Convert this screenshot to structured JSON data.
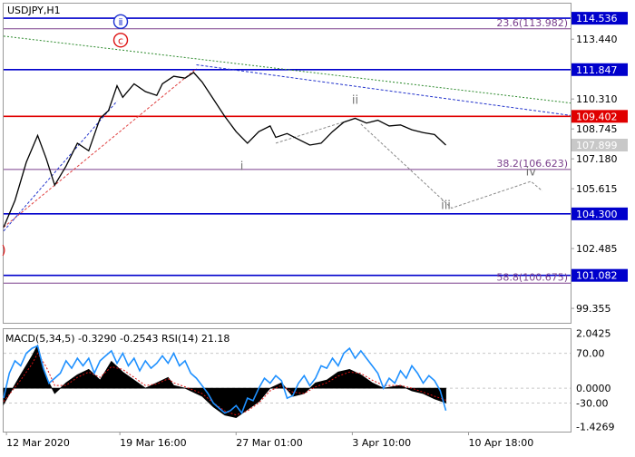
{
  "chart_data": [
    {
      "type": "line",
      "symbol_label": "USDJPY,H1",
      "y_ticks": [
        {
          "value": 113.44,
          "label": "113.440"
        },
        {
          "value": 110.31,
          "label": "110.310"
        },
        {
          "value": 108.745,
          "label": "108.745"
        },
        {
          "value": 107.18,
          "label": "107.180"
        },
        {
          "value": 105.615,
          "label": "105.615"
        },
        {
          "value": 102.485,
          "label": "102.485"
        },
        {
          "value": 99.355,
          "label": "99.355"
        }
      ],
      "ylim": [
        98.6,
        115.3
      ],
      "horizontal_levels": [
        {
          "value": 114.536,
          "label": "114.536",
          "color": "#0000cc",
          "style": "solid"
        },
        {
          "value": 111.847,
          "label": "111.847",
          "color": "#0000cc",
          "style": "solid"
        },
        {
          "value": 109.402,
          "label": "109.402",
          "color": "#e00000",
          "style": "solid"
        },
        {
          "value": 104.3,
          "label": "104.300",
          "color": "#0000cc",
          "style": "solid"
        },
        {
          "value": 101.082,
          "label": "101.082",
          "color": "#0000cc",
          "style": "solid"
        }
      ],
      "fib_levels": [
        {
          "value": 113.982,
          "label": "23.6(113.982)"
        },
        {
          "value": 106.623,
          "label": "38.2(106.623)"
        },
        {
          "value": 100.675,
          "label": "58.8(100.675)"
        }
      ],
      "current_price": {
        "value": 107.899,
        "label": "107.899"
      },
      "wave_labels": [
        {
          "label": "ⅱ",
          "x": 0.2,
          "y": 114.17,
          "style": "circled-blue"
        },
        {
          "label": "c",
          "x": 0.2,
          "y": 113.2,
          "style": "circled-red"
        },
        {
          "label": ")",
          "x": 0.0,
          "y": 102.2,
          "style": "red"
        },
        {
          "label": "i",
          "x": 0.42,
          "y": 106.6,
          "style": "gray"
        },
        {
          "label": "ii",
          "x": 0.62,
          "y": 110.05,
          "style": "gray"
        },
        {
          "label": "iii",
          "x": 0.78,
          "y": 104.55,
          "style": "gray"
        },
        {
          "label": "iv",
          "x": 0.93,
          "y": 106.3,
          "style": "gray"
        }
      ],
      "price_series": [
        [
          0.0,
          103.6
        ],
        [
          0.02,
          105.0
        ],
        [
          0.04,
          107.0
        ],
        [
          0.06,
          108.4
        ],
        [
          0.075,
          107.2
        ],
        [
          0.09,
          105.8
        ],
        [
          0.11,
          106.8
        ],
        [
          0.13,
          108.0
        ],
        [
          0.15,
          107.6
        ],
        [
          0.17,
          109.3
        ],
        [
          0.185,
          109.7
        ],
        [
          0.2,
          111.0
        ],
        [
          0.21,
          110.4
        ],
        [
          0.23,
          111.1
        ],
        [
          0.25,
          110.7
        ],
        [
          0.27,
          110.5
        ],
        [
          0.28,
          111.1
        ],
        [
          0.3,
          111.5
        ],
        [
          0.32,
          111.4
        ],
        [
          0.335,
          111.7
        ],
        [
          0.35,
          111.2
        ],
        [
          0.37,
          110.3
        ],
        [
          0.39,
          109.4
        ],
        [
          0.41,
          108.6
        ],
        [
          0.43,
          108.0
        ],
        [
          0.45,
          108.6
        ],
        [
          0.47,
          108.9
        ],
        [
          0.48,
          108.3
        ],
        [
          0.5,
          108.5
        ],
        [
          0.52,
          108.2
        ],
        [
          0.54,
          107.9
        ],
        [
          0.56,
          108.0
        ],
        [
          0.58,
          108.6
        ],
        [
          0.6,
          109.1
        ],
        [
          0.62,
          109.3
        ],
        [
          0.64,
          109.05
        ],
        [
          0.66,
          109.2
        ],
        [
          0.68,
          108.9
        ],
        [
          0.7,
          108.95
        ],
        [
          0.72,
          108.7
        ],
        [
          0.74,
          108.55
        ],
        [
          0.76,
          108.45
        ],
        [
          0.78,
          107.9
        ]
      ],
      "wave_path_ii_iii_iv": [
        [
          0.63,
          109.0
        ],
        [
          0.79,
          104.6
        ],
        [
          0.93,
          106.0
        ],
        [
          0.95,
          105.5
        ]
      ],
      "wave_path_i_ii": [
        [
          0.48,
          108.0
        ],
        [
          0.62,
          109.3
        ]
      ]
    },
    {
      "type": "line",
      "indicator_label": "MACD(5,34,5) -0.3290 -0.2543 RSI(14) 21.18",
      "left_ticks": [
        {
          "value": 2.0425,
          "label": "2.0425"
        },
        {
          "value": 0.0,
          "label": "0.0000"
        },
        {
          "value": -1.4269,
          "label": "-1.4269"
        }
      ],
      "right_ticks": [
        {
          "value": 70,
          "label": "70.00"
        },
        {
          "value": -30,
          "label": "-30.00"
        }
      ],
      "x_tick_labels": [
        "12 Mar 2020",
        "19 Mar 16:00",
        "27 Mar 01:00",
        "3 Apr 10:00",
        "10 Apr 18:00"
      ],
      "macd_hist": [
        [
          0.0,
          -0.6
        ],
        [
          0.03,
          0.5
        ],
        [
          0.05,
          1.2
        ],
        [
          0.06,
          1.6
        ],
        [
          0.075,
          0.4
        ],
        [
          0.09,
          -0.2
        ],
        [
          0.11,
          0.2
        ],
        [
          0.13,
          0.5
        ],
        [
          0.15,
          0.7
        ],
        [
          0.17,
          0.3
        ],
        [
          0.19,
          1.0
        ],
        [
          0.21,
          0.6
        ],
        [
          0.23,
          0.3
        ],
        [
          0.25,
          0.0
        ],
        [
          0.27,
          0.2
        ],
        [
          0.29,
          0.4
        ],
        [
          0.3,
          0.1
        ],
        [
          0.32,
          0.0
        ],
        [
          0.35,
          -0.3
        ],
        [
          0.37,
          -0.7
        ],
        [
          0.39,
          -1.0
        ],
        [
          0.41,
          -1.1
        ],
        [
          0.43,
          -0.8
        ],
        [
          0.45,
          -0.5
        ],
        [
          0.47,
          0.0
        ],
        [
          0.49,
          0.2
        ],
        [
          0.51,
          -0.3
        ],
        [
          0.53,
          -0.2
        ],
        [
          0.55,
          0.2
        ],
        [
          0.57,
          0.3
        ],
        [
          0.59,
          0.6
        ],
        [
          0.61,
          0.7
        ],
        [
          0.63,
          0.5
        ],
        [
          0.65,
          0.2
        ],
        [
          0.67,
          0.0
        ],
        [
          0.7,
          0.1
        ],
        [
          0.72,
          -0.1
        ],
        [
          0.74,
          -0.2
        ],
        [
          0.76,
          -0.4
        ],
        [
          0.78,
          -0.55
        ]
      ],
      "macd_signal": [
        [
          0.0,
          -0.5
        ],
        [
          0.03,
          0.3
        ],
        [
          0.05,
          0.9
        ],
        [
          0.06,
          1.3
        ],
        [
          0.075,
          0.8
        ],
        [
          0.09,
          0.1
        ],
        [
          0.11,
          0.1
        ],
        [
          0.13,
          0.4
        ],
        [
          0.15,
          0.6
        ],
        [
          0.17,
          0.4
        ],
        [
          0.19,
          0.8
        ],
        [
          0.21,
          0.7
        ],
        [
          0.23,
          0.4
        ],
        [
          0.25,
          0.1
        ],
        [
          0.27,
          0.15
        ],
        [
          0.29,
          0.35
        ],
        [
          0.3,
          0.2
        ],
        [
          0.32,
          0.05
        ],
        [
          0.35,
          -0.2
        ],
        [
          0.37,
          -0.55
        ],
        [
          0.39,
          -0.85
        ],
        [
          0.41,
          -1.0
        ],
        [
          0.43,
          -0.85
        ],
        [
          0.45,
          -0.55
        ],
        [
          0.47,
          -0.1
        ],
        [
          0.49,
          0.1
        ],
        [
          0.51,
          -0.15
        ],
        [
          0.53,
          -0.2
        ],
        [
          0.55,
          0.05
        ],
        [
          0.57,
          0.2
        ],
        [
          0.59,
          0.45
        ],
        [
          0.61,
          0.6
        ],
        [
          0.63,
          0.55
        ],
        [
          0.65,
          0.3
        ],
        [
          0.67,
          0.1
        ],
        [
          0.7,
          0.1
        ],
        [
          0.72,
          0.0
        ],
        [
          0.74,
          -0.15
        ],
        [
          0.76,
          -0.3
        ],
        [
          0.78,
          -0.45
        ]
      ],
      "rsi": [
        [
          0.0,
          -20
        ],
        [
          0.01,
          30
        ],
        [
          0.02,
          55
        ],
        [
          0.03,
          45
        ],
        [
          0.04,
          70
        ],
        [
          0.05,
          80
        ],
        [
          0.06,
          85
        ],
        [
          0.07,
          40
        ],
        [
          0.08,
          10
        ],
        [
          0.09,
          20
        ],
        [
          0.1,
          30
        ],
        [
          0.11,
          55
        ],
        [
          0.12,
          40
        ],
        [
          0.13,
          60
        ],
        [
          0.14,
          45
        ],
        [
          0.15,
          60
        ],
        [
          0.16,
          30
        ],
        [
          0.17,
          55
        ],
        [
          0.18,
          65
        ],
        [
          0.19,
          75
        ],
        [
          0.2,
          50
        ],
        [
          0.21,
          70
        ],
        [
          0.22,
          45
        ],
        [
          0.23,
          60
        ],
        [
          0.24,
          35
        ],
        [
          0.25,
          55
        ],
        [
          0.26,
          40
        ],
        [
          0.27,
          50
        ],
        [
          0.28,
          65
        ],
        [
          0.29,
          50
        ],
        [
          0.3,
          70
        ],
        [
          0.31,
          45
        ],
        [
          0.32,
          55
        ],
        [
          0.33,
          30
        ],
        [
          0.34,
          20
        ],
        [
          0.35,
          5
        ],
        [
          0.36,
          -10
        ],
        [
          0.37,
          -30
        ],
        [
          0.38,
          -40
        ],
        [
          0.39,
          -50
        ],
        [
          0.4,
          -45
        ],
        [
          0.41,
          -35
        ],
        [
          0.42,
          -50
        ],
        [
          0.43,
          -20
        ],
        [
          0.44,
          -25
        ],
        [
          0.45,
          0
        ],
        [
          0.46,
          20
        ],
        [
          0.47,
          10
        ],
        [
          0.48,
          25
        ],
        [
          0.49,
          15
        ],
        [
          0.5,
          -20
        ],
        [
          0.51,
          -15
        ],
        [
          0.52,
          10
        ],
        [
          0.53,
          25
        ],
        [
          0.54,
          5
        ],
        [
          0.55,
          20
        ],
        [
          0.56,
          45
        ],
        [
          0.57,
          40
        ],
        [
          0.58,
          60
        ],
        [
          0.59,
          45
        ],
        [
          0.6,
          70
        ],
        [
          0.61,
          80
        ],
        [
          0.62,
          60
        ],
        [
          0.63,
          75
        ],
        [
          0.64,
          60
        ],
        [
          0.65,
          45
        ],
        [
          0.66,
          30
        ],
        [
          0.67,
          0
        ],
        [
          0.68,
          20
        ],
        [
          0.69,
          10
        ],
        [
          0.7,
          35
        ],
        [
          0.71,
          20
        ],
        [
          0.72,
          45
        ],
        [
          0.73,
          30
        ],
        [
          0.74,
          10
        ],
        [
          0.75,
          25
        ],
        [
          0.76,
          15
        ],
        [
          0.77,
          -5
        ],
        [
          0.78,
          -45
        ]
      ]
    }
  ]
}
